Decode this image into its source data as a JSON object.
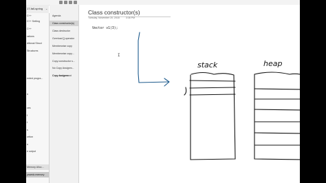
{
  "notebook": {
    "name": "17-fall-spring",
    "chevron": "⌄"
  },
  "sections": [
    {
      "label": "C++"
    },
    {
      "label": "C++ Setting"
    },
    {
      "label": "C++"
    },
    {
      "label": "rations"
    },
    {
      "label": "ditional Struct"
    },
    {
      "label": "Structures"
    },
    {
      "label": ""
    },
    {
      "label": "ented progra..."
    },
    {
      "label": ""
    },
    {
      "label": "n"
    },
    {
      "label": ""
    },
    {
      "label": "ces"
    },
    {
      "label": "f"
    },
    {
      "label": "t"
    },
    {
      "label": "s"
    },
    {
      "label": "ortion"
    },
    {
      "label": "n"
    },
    {
      "label": "e output"
    },
    {
      "label": "Memory Alloc..."
    },
    {
      "label": "ynamic memory"
    }
  ],
  "pages": [
    {
      "label": "Agenda"
    },
    {
      "label": "Class constructor(s)"
    },
    {
      "label": "Class destructor"
    },
    {
      "label": "Overload [] operator"
    },
    {
      "label": "Memberwise copy"
    },
    {
      "label": "Memberwise copy..."
    },
    {
      "label": "Copy constructor s..."
    },
    {
      "label": "No Copy Assignm..."
    },
    {
      "label": "Copy Assignm..."
    },
    {
      "label": "Copy assignment"
    }
  ],
  "page": {
    "title": "Class constructor(s)",
    "date": "Tuesday, November 20, 2018",
    "time": "3:36 PM",
    "code": "Vector v1(3);"
  },
  "ink": {
    "stack_label": "stack",
    "heap_label": "heap",
    "color_main": "#141414",
    "color_arrow": "#1d5a8c"
  },
  "colors": {
    "background": "#000000",
    "app": "#ffffff",
    "sidebar": "#f7f7f7",
    "pages": "#f1f1f1"
  }
}
